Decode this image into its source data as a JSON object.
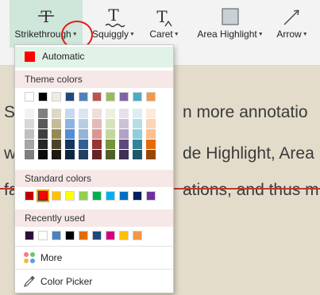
{
  "toolbar": {
    "tools": [
      {
        "label": "Strikethrough",
        "icon": "strikethrough-icon"
      },
      {
        "label": "Squiggly",
        "icon": "squiggly-icon"
      },
      {
        "label": "Caret",
        "icon": "caret-text-icon"
      },
      {
        "label": "Area Highlight",
        "icon": "area-highlight-icon"
      },
      {
        "label": "Arrow",
        "icon": "arrow-icon"
      }
    ],
    "glyphs": {
      "strike": "T",
      "squiggly": "T",
      "caret": "T"
    }
  },
  "document": {
    "line1_left": "Sy",
    "line1_right": "n more annotatio",
    "line2_left": "w",
    "line2_right": "de Highlight, Area",
    "line3_left": "fa",
    "line3_right": "ations, and thus m"
  },
  "menu": {
    "automatic_label": "Automatic",
    "automatic_color": "#ff0000",
    "theme_label": "Theme colors",
    "theme_top": [
      "#ffffff",
      "#000000",
      "#eeece1",
      "#1f497d",
      "#4f81bd",
      "#c0504d",
      "#9bbb59",
      "#8064a2",
      "#4bacc6",
      "#f79646"
    ],
    "theme_shades": [
      [
        "#f2f2f2",
        "#d8d8d8",
        "#bfbfbf",
        "#a5a5a5",
        "#7f7f7f"
      ],
      [
        "#7f7f7f",
        "#595959",
        "#3f3f3f",
        "#262626",
        "#0c0c0c"
      ],
      [
        "#ddd9c3",
        "#c4bd97",
        "#938953",
        "#494429",
        "#1d1b10"
      ],
      [
        "#c6d9f0",
        "#8db3e2",
        "#548dd4",
        "#17365d",
        "#0f243e"
      ],
      [
        "#dbe5f1",
        "#b8cce4",
        "#95b3d7",
        "#366092",
        "#244061"
      ],
      [
        "#f2dcdb",
        "#e5b9b7",
        "#d99694",
        "#953734",
        "#632423"
      ],
      [
        "#ebf1dd",
        "#d7e3bc",
        "#c3d69b",
        "#76923c",
        "#4f6128"
      ],
      [
        "#e5e0ec",
        "#ccc1d9",
        "#b2a2c7",
        "#5f497a",
        "#3f3151"
      ],
      [
        "#dbeef3",
        "#b7dde8",
        "#92cddc",
        "#31859b",
        "#205867"
      ],
      [
        "#fdeada",
        "#fbd5b5",
        "#fac08f",
        "#e36c09",
        "#974806"
      ]
    ],
    "standard_label": "Standard colors",
    "standard": [
      "#c00000",
      "#ff0000",
      "#ffc000",
      "#ffff00",
      "#92d050",
      "#00b050",
      "#00b0f0",
      "#0070c0",
      "#002060",
      "#7030a0"
    ],
    "standard_selected_index": 1,
    "recent_label": "Recently used",
    "recent": [
      "#2e0f3a",
      "#ffffff",
      "#4f81bd",
      "#000000",
      "#e36c09",
      "#1f497d",
      "#d40080",
      "#ffc000",
      "#f79646"
    ],
    "more_label": "More",
    "picker_label": "Color Picker"
  }
}
